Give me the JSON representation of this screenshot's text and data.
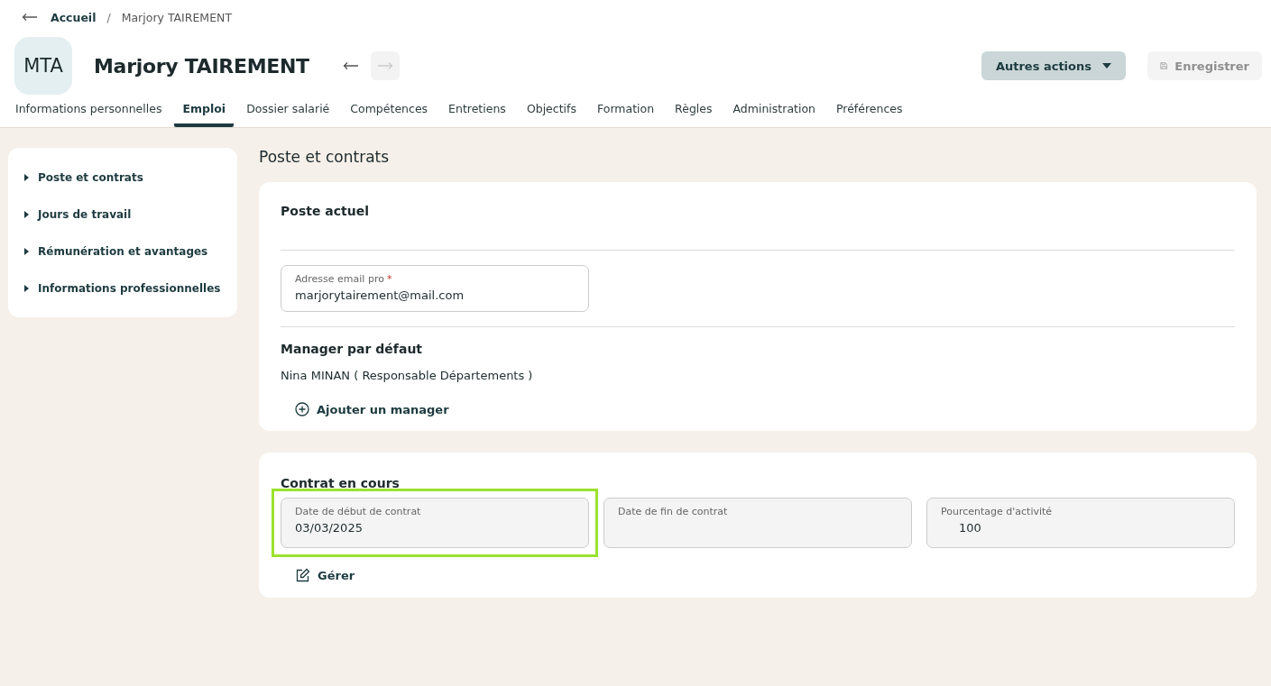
{
  "breadcrumb": {
    "home": "Accueil",
    "separator": "/",
    "current": "Marjory TAIREMENT"
  },
  "header": {
    "initials": "MTA",
    "name": "Marjory TAIREMENT",
    "prev_disabled": false,
    "next_disabled": true,
    "actions": [
      {
        "kind": "menu",
        "label": "Autres actions",
        "disabled": false
      },
      {
        "kind": "save",
        "label": "Enregistrer",
        "disabled": true
      }
    ]
  },
  "tabs": [
    {
      "label": "Informations personnelles",
      "selected": false
    },
    {
      "label": "Emploi",
      "selected": true
    },
    {
      "label": "Dossier salarié",
      "selected": false
    },
    {
      "label": "Compétences",
      "selected": false
    },
    {
      "label": "Entretiens",
      "selected": false
    },
    {
      "label": "Objectifs",
      "selected": false
    },
    {
      "label": "Formation",
      "selected": false
    },
    {
      "label": "Règles",
      "selected": false
    },
    {
      "label": "Administration",
      "selected": false
    },
    {
      "label": "Préférences",
      "selected": false
    }
  ],
  "sidebar": {
    "items": [
      "Poste et contrats",
      "Jours de travail",
      "Rémunération et avantages",
      "Informations professionnelles"
    ]
  },
  "page_title": "Poste et contrats",
  "poste_actuel": {
    "title": "Poste actuel",
    "email_field": {
      "label": "Adresse email pro",
      "required": true,
      "required_mark": "*",
      "value": "marjorytairement@mail.com"
    },
    "manager_title": "Manager par défaut",
    "manager": "Nina MINAN ( Responsable Départements )",
    "add_manager": "Ajouter un manager"
  },
  "contrat": {
    "title": "Contrat en cours",
    "fields": [
      {
        "label": "Date de début de contrat",
        "value": "03/03/2025",
        "highlighted": true
      },
      {
        "label": "Date de fin de contrat",
        "highlighted": false
      },
      {
        "label": "Pourcentage d'activité",
        "value": "100",
        "highlighted": false
      }
    ],
    "manage": "Gérer"
  }
}
